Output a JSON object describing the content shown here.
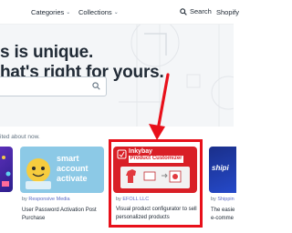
{
  "nav": {
    "categories": "Categories",
    "collections": "Collections",
    "search": "Search",
    "shopify": "Shopify"
  },
  "hero": {
    "line1": "s is unique.",
    "line2": "hat's right for yours.",
    "search_value": "",
    "search_placeholder": ""
  },
  "section": {
    "label": "ited about now."
  },
  "cards": [
    {
      "image_text_1": "smart",
      "image_text_2": "account",
      "image_text_3": "activate",
      "by_prefix": "by",
      "developer": "Responsive Media",
      "title_line1": "User Password Activation Post",
      "title_line2": "Purchase"
    },
    {
      "image_text_1": "Inkybay",
      "image_text_2": "Product Customizer",
      "by_prefix": "by",
      "developer": "EFOLL LLC",
      "title_line1": "Visual product configurator to sell",
      "title_line2": "personalized products"
    },
    {
      "image_text_1": "shipi",
      "by_prefix": "by",
      "developer": "Shippin",
      "title_line1": "The easie",
      "title_line2": "e-comme"
    }
  ],
  "colors": {
    "highlight": "#e8101a",
    "brand_red": "#d91f26",
    "smart_bg": "#8cc9e6",
    "link": "#5c6ac4"
  }
}
